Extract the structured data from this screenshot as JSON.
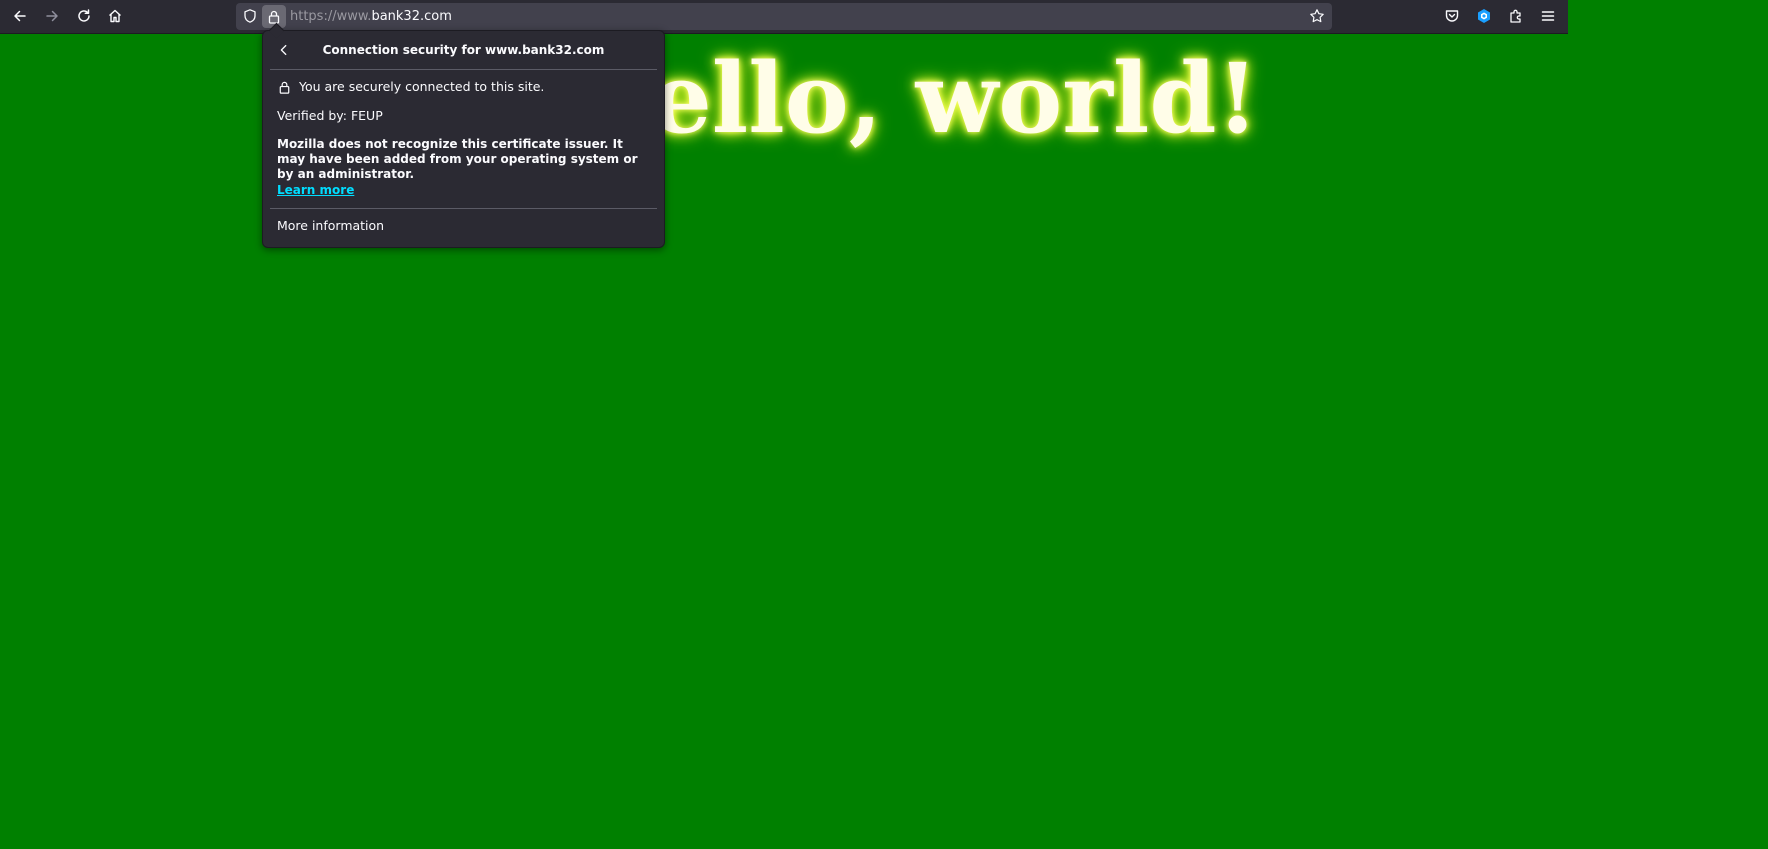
{
  "browser": {
    "url_scheme": "https://www.",
    "url_host": "bank32.com",
    "icons": {
      "back": "back-arrow-icon",
      "forward": "forward-arrow-icon",
      "reload": "reload-icon",
      "home": "home-icon",
      "tracking_protection": "shield-icon",
      "site_security": "lock-icon",
      "bookmark": "star-icon",
      "pocket": "pocket-icon",
      "extension": "extension-badge-icon",
      "extensions_menu": "puzzle-icon",
      "app_menu": "hamburger-menu-icon"
    }
  },
  "page": {
    "heading": "Hello, world!",
    "background_color": "#008000",
    "glow_color": "#ffff66"
  },
  "security_panel": {
    "title": "Connection security for www.bank32.com",
    "secure_message": "You are securely connected to this site.",
    "verified_by": "Verified by: FEUP",
    "warning": "Mozilla does not recognize this certificate issuer. It may have been added from your operating system or by an administrator.",
    "learn_more": "Learn more",
    "more_information": "More information",
    "link_color": "#00ddff"
  }
}
